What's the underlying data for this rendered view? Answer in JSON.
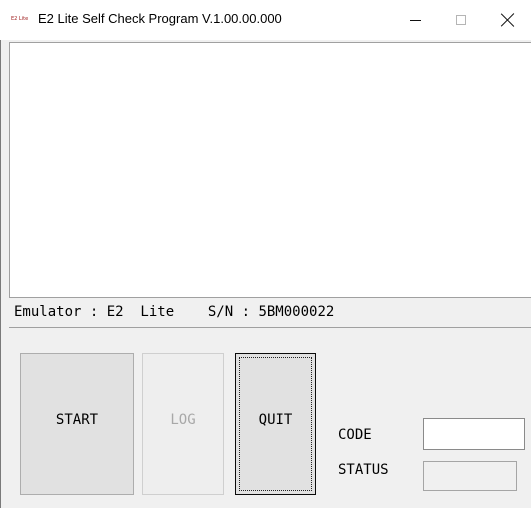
{
  "window": {
    "icon_text": "E2 Lite",
    "title": "E2 Lite Self Check Program V.1.00.00.000"
  },
  "log": {
    "content": ""
  },
  "info": {
    "emulator_label": "Emulator : ",
    "emulator_value": "E2  Lite",
    "sn_label": "S/N : ",
    "sn_value": "5BM000022"
  },
  "buttons": {
    "start": "START",
    "log": "LOG",
    "quit": "QUIT"
  },
  "fields": {
    "code_label": "CODE",
    "code_value": "",
    "status_label": "STATUS",
    "status_value": ""
  }
}
